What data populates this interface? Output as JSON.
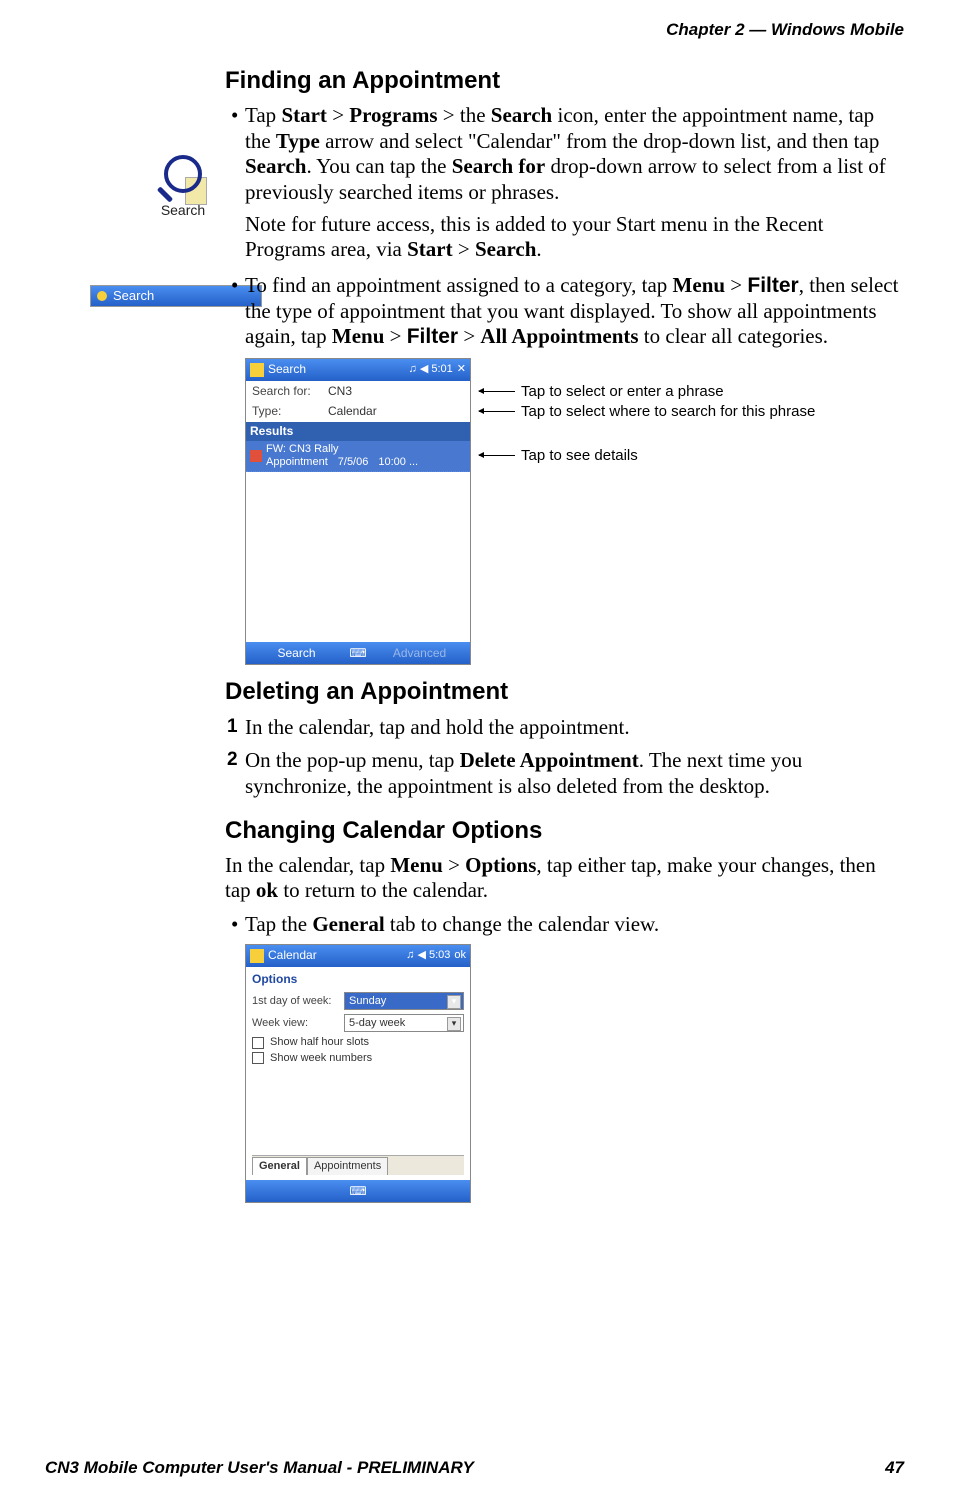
{
  "header": {
    "chapter_label": "Chapter 2 —  Windows Mobile"
  },
  "headings": {
    "finding": "Finding an Appointment",
    "deleting": "Deleting an Appointment",
    "changing": "Changing Calendar Options"
  },
  "finding": {
    "bullet1_pre": "Tap ",
    "start": "Start",
    "gt": " > ",
    "programs": "Programs",
    "post1": " > the ",
    "search": "Search",
    "post2": " icon, enter the appointment name, tap the ",
    "type": "Type",
    "post3": " arrow and select \"Calendar\" from the drop-down list, and then tap ",
    "search2": "Search",
    "post4": ". You can tap the ",
    "searchfor": "Search for",
    "post5": " drop-down arrow to select from a list of previously searched items or phrases.",
    "note_pre": "Note for future access, this is added to your Start menu in the Recent Programs area, via ",
    "note_start": "Start",
    "note_gt": " > ",
    "note_search": "Search",
    "note_post": ".",
    "bullet2_pre": "To find an appointment assigned to a category, tap ",
    "menu": "Menu",
    "filter": "Filter",
    "b2_mid": ", then select the type of appointment that you want displayed. To show all appointments again, tap ",
    "allappts": "All Appointments",
    "b2_post": " to clear all categories."
  },
  "search_icon_caption": "Search",
  "start_menu_chip": "Search",
  "search_shot": {
    "title": "Search",
    "signal": "♫ ◀ 5:01",
    "close": "✕",
    "search_for_label": "Search for:",
    "search_for_value": "CN3",
    "type_label": "Type:",
    "type_value": "Calendar",
    "results_label": "Results",
    "result_line1": "FW: CN3 Rally",
    "result_line2a": "Appointment",
    "result_line2b": "7/5/06",
    "result_line2c": "10:00 ...",
    "softkey_left": "Search",
    "softkey_right": "Advanced"
  },
  "callouts": {
    "phrase": "Tap to select or enter a phrase",
    "where": "Tap to select where to search for this phrase",
    "details": "Tap to see details"
  },
  "deleting": {
    "step1": "In the calendar, tap and hold the appointment.",
    "step2_pre": "On the pop-up menu, tap ",
    "step2_bold": "Delete Appointment",
    "step2_post": ". The next time you synchronize, the appointment is also deleted from the desktop."
  },
  "changing": {
    "intro_pre": "In the calendar, tap ",
    "menu": "Menu",
    "gt": " > ",
    "options": "Options",
    "intro_mid": ", tap either tap, make your changes, then tap ",
    "ok": "ok",
    "intro_post": " to return to the calendar.",
    "bullet_pre": "Tap the ",
    "general": "General",
    "bullet_post": " tab to change the calendar view."
  },
  "calendar_shot": {
    "title": "Calendar",
    "signal": "♫ ◀ 5:03",
    "ok": "ok",
    "options_heading": "Options",
    "row1_label": "1st day of week:",
    "row1_value": "Sunday",
    "row2_label": "Week view:",
    "row2_value": "5-day week",
    "check1": "Show half hour slots",
    "check2": "Show week numbers",
    "tab_general": "General",
    "tab_appointments": "Appointments"
  },
  "footer": {
    "left": "CN3 Mobile Computer User's Manual - PRELIMINARY",
    "right": "47"
  }
}
